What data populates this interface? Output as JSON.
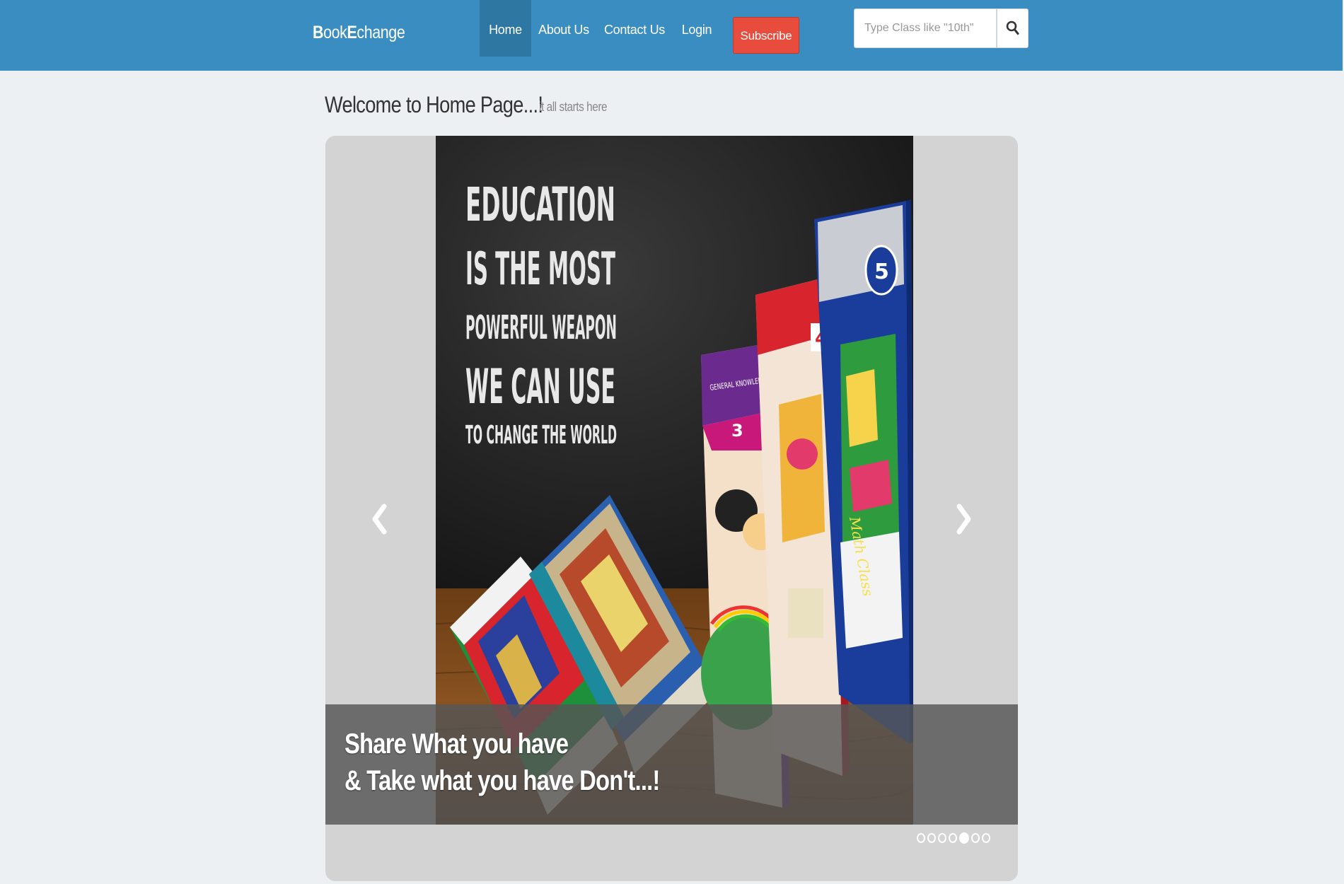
{
  "navbar": {
    "brand_bold_1": "B",
    "brand_rest_1": "ook",
    "brand_bold_2": "E",
    "brand_rest_2": "change",
    "items": [
      {
        "label": "Home",
        "active": true
      },
      {
        "label": "About Us",
        "active": false
      },
      {
        "label": "Contact Us",
        "active": false
      },
      {
        "label": "Login",
        "active": false
      }
    ],
    "subscribe_label": "Subscribe",
    "search_placeholder": "Type Class like \"10th\"",
    "colors": {
      "bar": "#3a8dc0",
      "active": "#2f77a3",
      "subscribe": "#e74c3c"
    }
  },
  "header": {
    "title": "Welcome to Home Page...!",
    "subtitle": "it all starts here"
  },
  "carousel": {
    "slide_quote": [
      "EDUCATION",
      "IS THE MOST",
      "POWERFUL WEAPON",
      "WE CAN USE",
      "TO CHANGE THE WORLD"
    ],
    "caption_line_1": "Share What you have",
    "caption_line_2": "& Take what you have Don't...!",
    "slide_count": 7,
    "active_index": 4,
    "book_labels": {
      "grade_3_title": "GENERAL KNOWLEDGE",
      "grade_3_number": "3",
      "grade_4_number": "4",
      "grade_5_number": "5",
      "math_class": "Math Class"
    }
  }
}
